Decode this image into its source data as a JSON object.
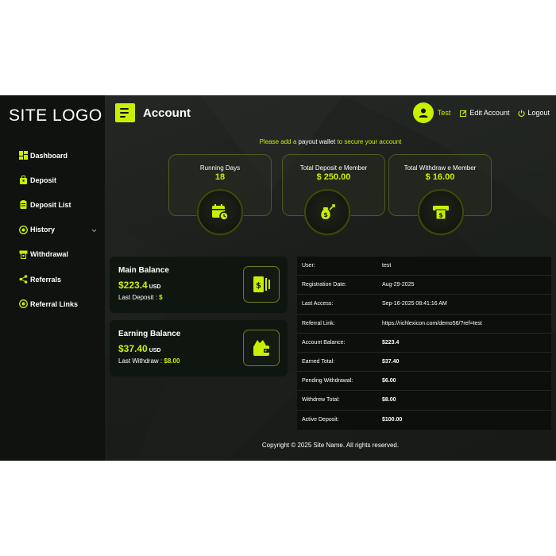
{
  "sidebar": {
    "logo": "SITE LOGO",
    "items": [
      {
        "label": "Dashboard",
        "icon": "dashboard-icon"
      },
      {
        "label": "Deposit",
        "icon": "deposit-bag-icon"
      },
      {
        "label": "Deposit List",
        "icon": "clipboard-icon"
      },
      {
        "label": "History",
        "icon": "history-icon"
      },
      {
        "label": "Withdrawal",
        "icon": "withdraw-icon"
      },
      {
        "label": "Referrals",
        "icon": "share-icon"
      },
      {
        "label": "Referral Links",
        "icon": "link-icon"
      }
    ]
  },
  "header": {
    "title": "Account",
    "username": "Test",
    "edit_account": "Edit Account",
    "logout": "Logout"
  },
  "notice": {
    "part1": "Please add a",
    "part2": "payout wallet",
    "part3": "to secure your account"
  },
  "stats": [
    {
      "label": "Running Days",
      "value": "18",
      "icon": "calendar-clock-icon"
    },
    {
      "label": "Total Deposit e Member",
      "value": "$ 250.00",
      "icon": "money-bag-icon"
    },
    {
      "label": "Total Withdraw e Member",
      "value": "$ 16.00",
      "icon": "atm-withdraw-icon"
    }
  ],
  "main_balance": {
    "title": "Main Balance",
    "amount": "$223.4",
    "currency": "USD",
    "sub_label": "Last Deposit :",
    "sub_value": "$"
  },
  "earning_balance": {
    "title": "Earning Balance",
    "amount": "$37.40",
    "currency": "USD",
    "sub_label": "Last Withdraw :",
    "sub_value": "$8.00"
  },
  "account_info": [
    {
      "key": "User:",
      "value": "test",
      "bold": false
    },
    {
      "key": "Registration Date:",
      "value": "Aug-29-2025",
      "bold": false
    },
    {
      "key": "Last Access:",
      "value": "Sep-16-2025 08:41:16 AM",
      "bold": false
    },
    {
      "key": "Referral Link:",
      "value": "https://richlexicon.com/demo56/?ref=test",
      "bold": false
    },
    {
      "key": "Account Balance:",
      "value": "$223.4",
      "bold": true
    },
    {
      "key": "Earned Total:",
      "value": "$37.40",
      "bold": true
    },
    {
      "key": "Pending Withdrawal:",
      "value": "$6.00",
      "bold": true
    },
    {
      "key": "Withdrew Total:",
      "value": "$8.00",
      "bold": true
    },
    {
      "key": "Active Deposit:",
      "value": "$100.00",
      "bold": true
    }
  ],
  "footer": "Copyright © 2025 Site Name. All rights reserved.",
  "colors": {
    "accent": "#c8f000",
    "sidebar_bg": "#0f120f",
    "card_bg": "#0f1610"
  }
}
